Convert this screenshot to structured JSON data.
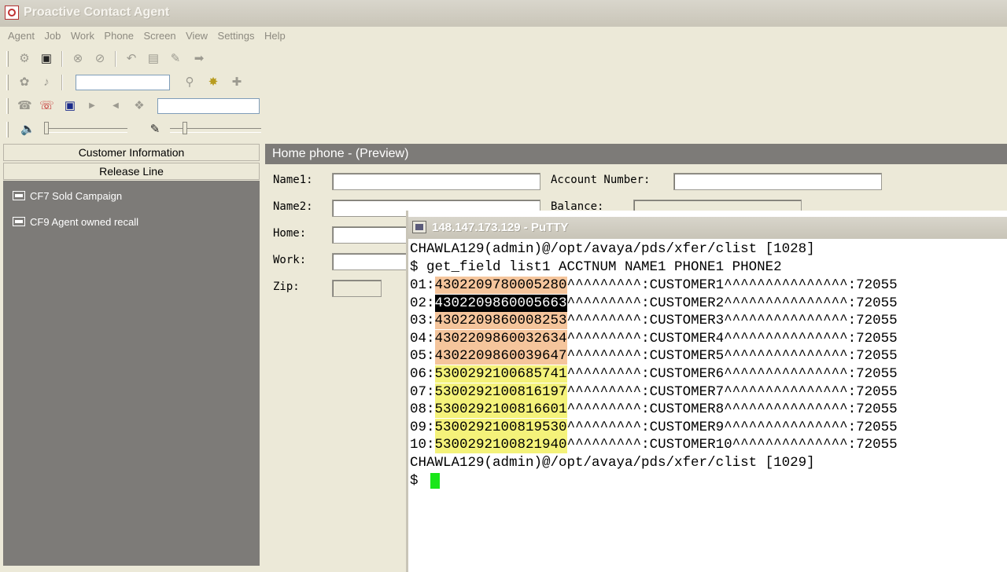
{
  "window": {
    "title": "Proactive Contact Agent"
  },
  "menu": [
    "Agent",
    "Job",
    "Work",
    "Phone",
    "Screen",
    "View",
    "Settings",
    "Help"
  ],
  "left_panel": {
    "header": "Customer Information",
    "subheader": "Release Line",
    "items": [
      {
        "label": "CF7 Sold Campaign"
      },
      {
        "label": "CF9 Agent owned recall"
      }
    ]
  },
  "preview": {
    "title": "Home phone - (Preview)",
    "labels": {
      "name1": "Name1:",
      "name2": "Name2:",
      "home": "Home:",
      "work": "Work:",
      "zip": "Zip:",
      "account_number": "Account Number:",
      "balance": "Balance:"
    }
  },
  "putty": {
    "title": "148.147.173.129 - PuTTY",
    "prompt1": "CHAWLA129(admin)@/opt/avaya/pds/xfer/clist [1028]",
    "command": "$ get_field list1 ACCTNUM NAME1 PHONE1 PHONE2",
    "rows": [
      {
        "num": "01",
        "acct": "4302209780005280",
        "rest": "^^^^^^^^^:CUSTOMER1^^^^^^^^^^^^^^^:72055",
        "hl": "orange"
      },
      {
        "num": "02",
        "acct": "4302209860005663",
        "rest": "^^^^^^^^^:CUSTOMER2^^^^^^^^^^^^^^^:72055",
        "hl": "selected"
      },
      {
        "num": "03",
        "acct": "4302209860008253",
        "rest": "^^^^^^^^^:CUSTOMER3^^^^^^^^^^^^^^^:72055",
        "hl": "orange"
      },
      {
        "num": "04",
        "acct": "4302209860032634",
        "rest": "^^^^^^^^^:CUSTOMER4^^^^^^^^^^^^^^^:72055",
        "hl": "orange"
      },
      {
        "num": "05",
        "acct": "4302209860039647",
        "rest": "^^^^^^^^^:CUSTOMER5^^^^^^^^^^^^^^^:72055",
        "hl": "orange"
      },
      {
        "num": "06",
        "acct": "5300292100685741",
        "rest": "^^^^^^^^^:CUSTOMER6^^^^^^^^^^^^^^^:72055",
        "hl": "yellow"
      },
      {
        "num": "07",
        "acct": "5300292100816197",
        "rest": "^^^^^^^^^:CUSTOMER7^^^^^^^^^^^^^^^:72055",
        "hl": "yellow"
      },
      {
        "num": "08",
        "acct": "5300292100816601",
        "rest": "^^^^^^^^^:CUSTOMER8^^^^^^^^^^^^^^^:72055",
        "hl": "yellow"
      },
      {
        "num": "09",
        "acct": "5300292100819530",
        "rest": "^^^^^^^^^:CUSTOMER9^^^^^^^^^^^^^^^:72055",
        "hl": "yellow"
      },
      {
        "num": "10",
        "acct": "5300292100821940",
        "rest": "^^^^^^^^^:CUSTOMER10^^^^^^^^^^^^^^:72055",
        "hl": "yellow"
      }
    ],
    "prompt2": "CHAWLA129(admin)@/opt/avaya/pds/xfer/clist [1029]",
    "prompt_symbol": "$",
    "colors": {
      "orange": "#f5c59c",
      "yellow": "#f4f27a",
      "cursor": "#19e619"
    }
  },
  "icons": {
    "toolbar1": [
      "agent-login-icon",
      "logout-icon",
      "cancel-icon",
      "stop-icon",
      "undo-icon",
      "screen-icon",
      "edit-icon",
      "transfer-icon"
    ],
    "toolbar2": [
      "hold-icon",
      "music-icon",
      "search-icon",
      "settings-icon",
      "callback-icon"
    ],
    "toolbar3": [
      "phone-icon",
      "hangup-icon",
      "save-icon",
      "arrow-right-icon",
      "arrow-left-icon",
      "dial-icon"
    ],
    "toolbar4": [
      "speaker-icon",
      "microphone-icon"
    ]
  }
}
